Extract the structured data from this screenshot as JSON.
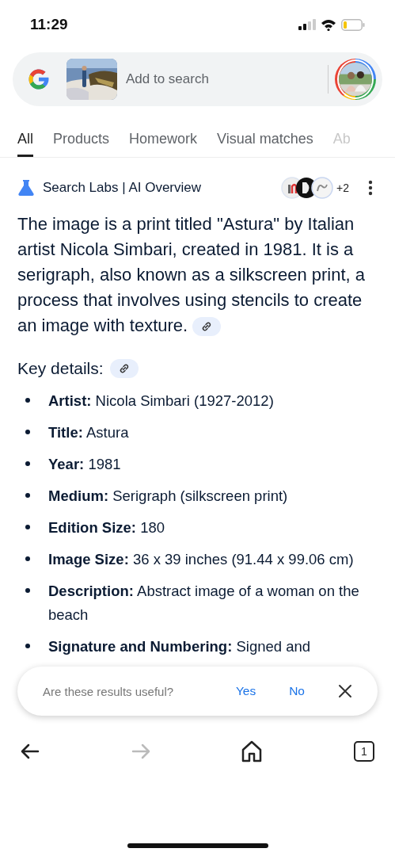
{
  "status_bar": {
    "time": "11:29"
  },
  "search_bar": {
    "placeholder": "Add to search"
  },
  "tabs": [
    {
      "label": "All",
      "selected": true
    },
    {
      "label": "Products",
      "selected": false
    },
    {
      "label": "Homework",
      "selected": false
    },
    {
      "label": "Visual matches",
      "selected": false
    },
    {
      "label": "Ab",
      "selected": false
    }
  ],
  "ai_overview": {
    "title": "Search Labs | AI Overview",
    "source_count": "+2",
    "summary": "The image is a print titled \"Astura\" by Italian artist Nicola Simbari, created in 1981. It is a serigraph, also known as a silkscreen print, a process that involves using stencils to create an image with texture.",
    "heading": "Key details:",
    "details": [
      {
        "text": "**Artist:** Nicola Simbari (1927-2012)"
      },
      {
        "text": "**Title:** Astura"
      },
      {
        "text": "**Year:** 1981"
      },
      {
        "text": "**Medium:** Serigraph (silkscreen print)"
      },
      {
        "text": "**Edition Size:** 180"
      },
      {
        "text": "**Image Size:** 36 x 39 inches (91.44 x 99.06 cm)"
      },
      {
        "text": "**Description:** Abstract image of a woman on the beach"
      },
      {
        "text": "**Signature and Numbering:** Signed and"
      }
    ]
  },
  "feedback": {
    "question": "Are these results useful?",
    "yes": "Yes",
    "no": "No"
  },
  "bottom_nav": {
    "forward_disabled": true,
    "tab_count": "1"
  }
}
